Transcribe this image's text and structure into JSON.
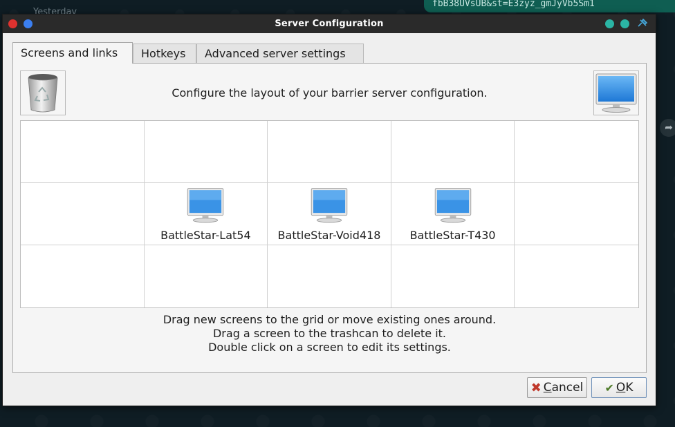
{
  "background": {
    "sidebar_date": "Yesterday",
    "chat_bubble_text": "fbB38UVsUB&st=E3zyz_gmJyVb5Sm1"
  },
  "window": {
    "title": "Server Configuration"
  },
  "tabs": [
    {
      "label": "Screens and links",
      "active": true
    },
    {
      "label": "Hotkeys",
      "active": false
    },
    {
      "label": "Advanced server settings",
      "active": false
    }
  ],
  "screens_tab": {
    "instruction": "Configure the layout of your barrier server configuration.",
    "grid": {
      "rows": 3,
      "cols": 5,
      "screens": [
        {
          "row": 1,
          "col": 1,
          "name": "BattleStar-Lat54"
        },
        {
          "row": 1,
          "col": 2,
          "name": "BattleStar-Void418"
        },
        {
          "row": 1,
          "col": 3,
          "name": "BattleStar-T430"
        }
      ]
    },
    "help_lines": [
      "Drag new screens to the grid or move existing ones around.",
      "Drag a screen to the trashcan to delete it.",
      "Double click on a screen to edit its settings."
    ]
  },
  "buttons": {
    "cancel_rest": "ancel",
    "cancel_mnemonic": "C",
    "ok_rest": "K",
    "ok_mnemonic": "O"
  },
  "colors": {
    "titlebar": "#2a2a2a",
    "close": "#e0322f",
    "maximize": "#3b7ff0",
    "teal": "#2bb5a5",
    "monitor_blue": "#3a93e6"
  }
}
